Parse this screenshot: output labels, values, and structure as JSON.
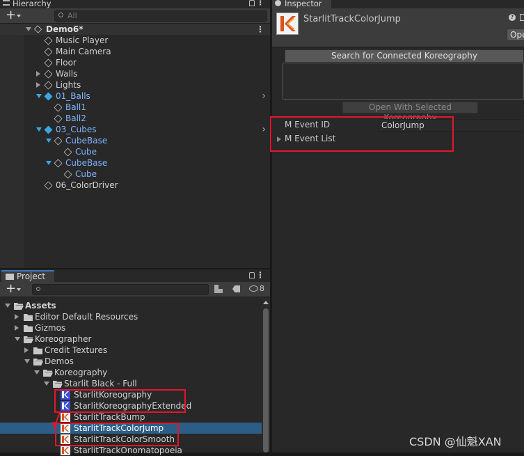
{
  "hierarchy": {
    "tab_label": "Hierarchy",
    "search_placeholder": "All",
    "scene_name": "Demo6*",
    "items": [
      {
        "label": "Music Player",
        "blue": false
      },
      {
        "label": "Main Camera",
        "blue": false
      },
      {
        "label": "Floor",
        "blue": false
      },
      {
        "label": "Walls",
        "blue": false
      },
      {
        "label": "Lights",
        "blue": false
      },
      {
        "label": "01_Balls",
        "blue": true
      },
      {
        "label": "Ball1",
        "blue": true
      },
      {
        "label": "Ball2",
        "blue": true
      },
      {
        "label": "03_Cubes",
        "blue": true
      },
      {
        "label": "CubeBase",
        "blue": true
      },
      {
        "label": "Cube",
        "blue": true
      },
      {
        "label": "CubeBase",
        "blue": true
      },
      {
        "label": "Cube",
        "blue": true
      },
      {
        "label": "06_ColorDriver",
        "blue": false
      }
    ]
  },
  "project": {
    "tab_label": "Project",
    "hidden_count": "8",
    "tree": [
      {
        "label": "Assets"
      },
      {
        "label": "Editor Default Resources"
      },
      {
        "label": "Gizmos"
      },
      {
        "label": "Koreographer"
      },
      {
        "label": "Credit Textures"
      },
      {
        "label": "Demos"
      },
      {
        "label": "Koreography"
      },
      {
        "label": "Starlit Black - Full"
      },
      {
        "label": "StarlitKoreography"
      },
      {
        "label": "StarlitKoreographyExtended"
      },
      {
        "label": "StarlitTrackBump"
      },
      {
        "label": "StarlitTrackColorJump"
      },
      {
        "label": "StarlitTrackColorSmooth"
      },
      {
        "label": "StarlitTrackOnomatopoeia"
      }
    ]
  },
  "inspector": {
    "tab_label": "Inspector",
    "object_name": "StarlitTrackColorJump",
    "open_label": "Ope",
    "search_button": "Search for Connected Koreography",
    "open_selected_button": "Open With Selected Koreography",
    "event_id_label": "M Event ID",
    "event_id_value": "ColorJump",
    "event_list_label": "M Event List"
  },
  "watermark": "CSDN @仙魁XAN",
  "colors": {
    "accent_red": "#e3162b",
    "selection": "#2c5d87",
    "link_blue": "#7fb4ff",
    "cube_blue": "#3aa6e6"
  }
}
